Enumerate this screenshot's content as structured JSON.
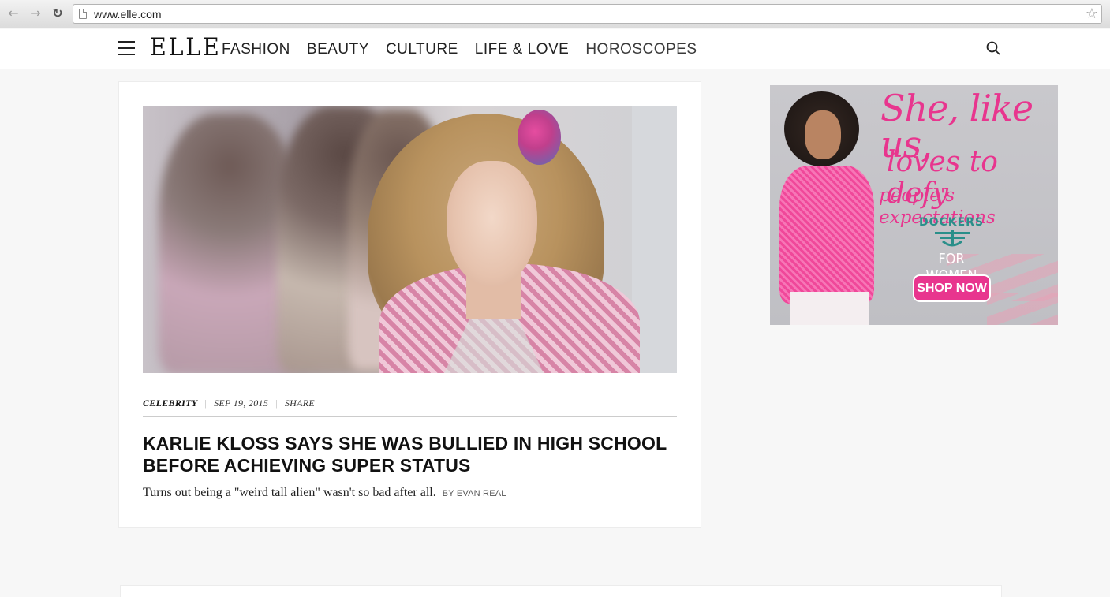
{
  "browser": {
    "url": "www.elle.com",
    "back_icon": "arrow-left-icon",
    "forward_icon": "arrow-right-icon",
    "reload_icon": "reload-icon",
    "star_icon": "star-icon"
  },
  "header": {
    "logo": "ELLE",
    "nav": [
      {
        "label": "FASHION"
      },
      {
        "label": "BEAUTY"
      },
      {
        "label": "CULTURE"
      },
      {
        "label": "LIFE & LOVE"
      },
      {
        "label": "HOROSCOPES"
      }
    ]
  },
  "article": {
    "category": "CELEBRITY",
    "date": "SEP 19, 2015",
    "share": "SHARE",
    "headline": "KARLIE KLOSS SAYS SHE WAS BULLIED IN HIGH SCHOOL BEFORE ACHIEVING SUPER STATUS",
    "dek": "Turns out being a \"weird tall alien\" wasn't so bad after all.",
    "byline": "BY EVAN REAL"
  },
  "ad": {
    "line1": "She, like us,",
    "line2": "loves to defy",
    "line3": "people's expectations",
    "brand": "DOCKERS",
    "sub": "FOR WOMEN",
    "cta": "SHOP NOW",
    "accent": "#e8358e"
  }
}
